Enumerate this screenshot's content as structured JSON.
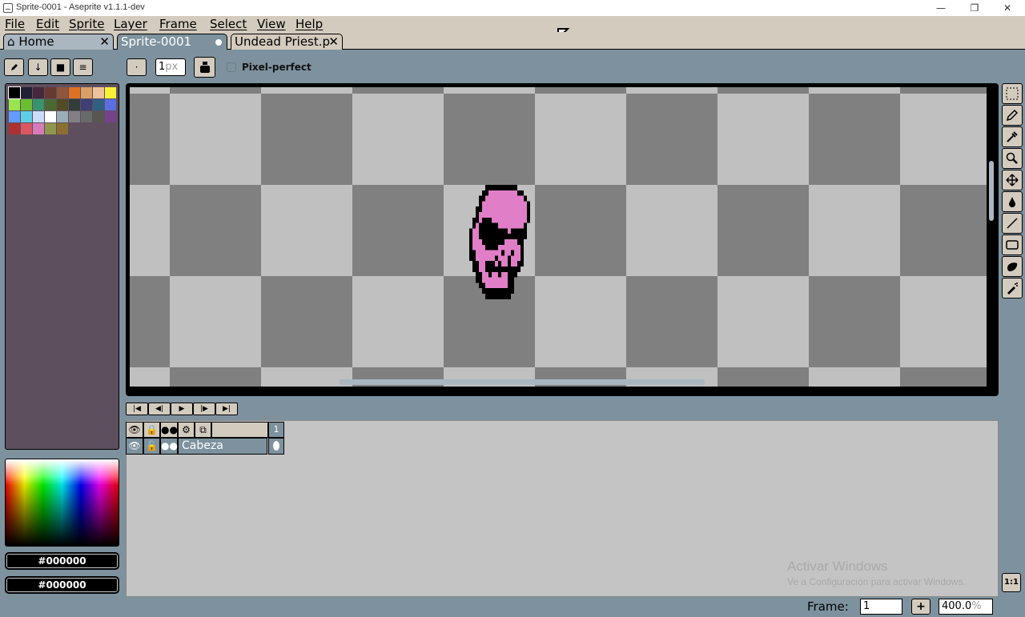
{
  "window": {
    "title": "Sprite-0001 - Aseprite v1.1.1-dev",
    "minimize": "—",
    "restore": "❐",
    "close": "✕"
  },
  "menu": [
    "File",
    "Edit",
    "Sprite",
    "Layer",
    "Frame",
    "Select",
    "View",
    "Help"
  ],
  "tabs": {
    "home": "Home",
    "sprite": "Sprite-0001",
    "undead": "Undead Priest.p",
    "close_glyph": "✕"
  },
  "toolbar_row": {
    "brush_type": "·",
    "brush_size": "1",
    "brush_unit": "px",
    "pixel_perfect": "Pixel-perfect"
  },
  "palette": {
    "colors": [
      "#000000",
      "#222034",
      "#45283c",
      "#663931",
      "#8f563b",
      "#df7126",
      "#d9a066",
      "#eec39a",
      "#fbf236",
      "#99e550",
      "#6abe30",
      "#37946e",
      "#4b692f",
      "#524b24",
      "#323c39",
      "#3f3f74",
      "#306082",
      "#5b6ee1",
      "#639bff",
      "#5fcde4",
      "#cbdbfc",
      "#ffffff",
      "#9badb7",
      "#847e87",
      "#696a6a",
      "#595652",
      "#76428a",
      "#ac3232",
      "#d95763",
      "#d77bba",
      "#8f974a",
      "#8a6f30"
    ]
  },
  "colors": {
    "foreground": "#000000",
    "background": "#000000",
    "accent": "#7d929e",
    "panel": "#5e4f5e",
    "sprite_fill": "#e07fc7"
  },
  "timeline": {
    "layer_name": "Cabeza",
    "frame_header": "1"
  },
  "watermark": {
    "title": "Activar Windows",
    "subtitle": "Ve a Configuración para activar Windows."
  },
  "status": {
    "frame_label": "Frame:",
    "frame_value": "1",
    "add_frame": "+",
    "zoom_value": "400.0",
    "zoom_unit": "%",
    "zoom_fit": "1:1"
  }
}
